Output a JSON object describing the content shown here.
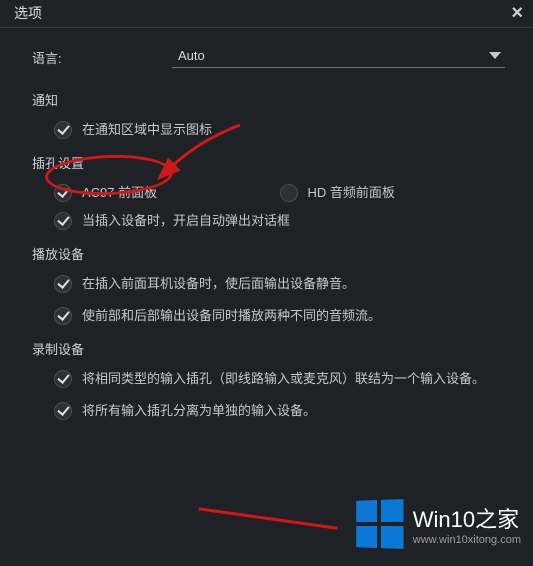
{
  "window": {
    "title": "选项"
  },
  "language": {
    "label": "语言:",
    "value": "Auto"
  },
  "notify": {
    "title": "通知",
    "show_tray_label": "在通知区域中显示图标"
  },
  "jack": {
    "title": "插孔设置",
    "ac97_label": "AC97 前面板",
    "hd_label": "HD 音频前面板",
    "autopopup_label": "当插入设备时，开启自动弹出对话框"
  },
  "playback": {
    "title": "播放设备",
    "mute_rear_label": "在插入前面耳机设备时，使后面输出设备静音。",
    "dual_stream_label": "使前部和后部输出设备同时播放两种不同的音频流。"
  },
  "record": {
    "title": "录制设备",
    "merge_label": "将相同类型的输入插孔（即线路输入或麦克风）联结为一个输入设备。",
    "split_label": "将所有输入插孔分离为单独的输入设备。"
  },
  "watermark": {
    "big": "Win10之家",
    "small": "www.win10xitong.com"
  }
}
